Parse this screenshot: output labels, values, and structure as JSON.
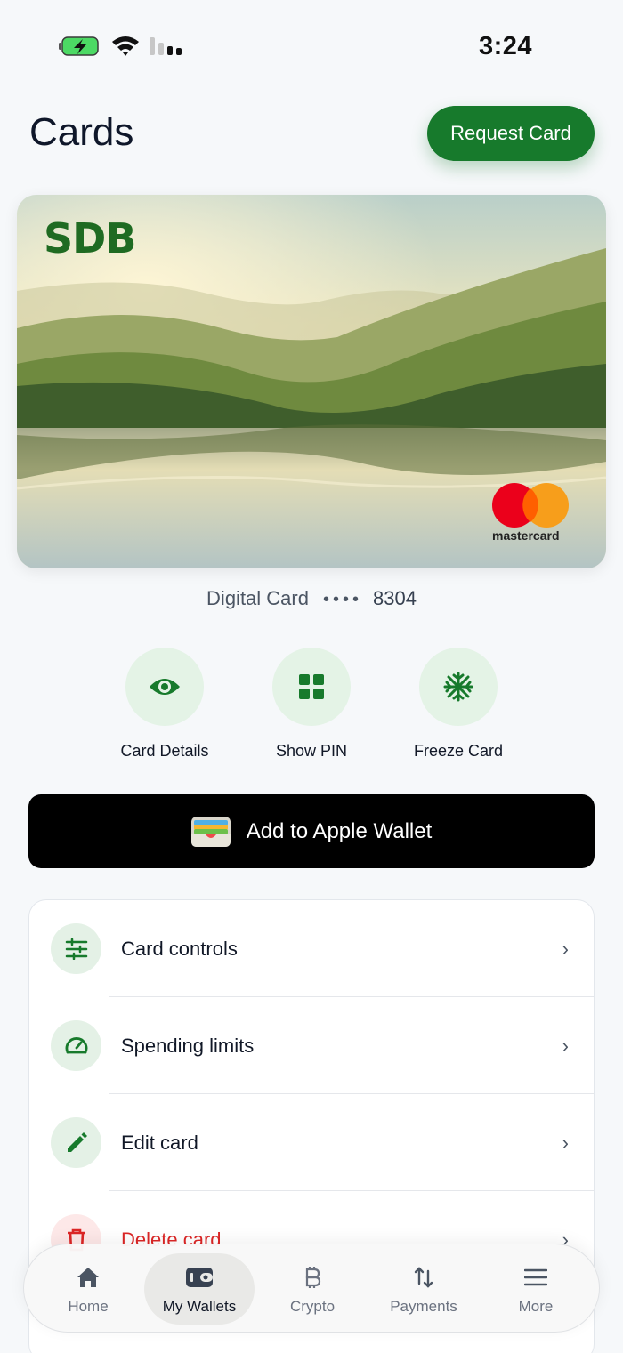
{
  "status_bar": {
    "time": "3:24"
  },
  "header": {
    "title": "Cards",
    "request_button": "Request Card"
  },
  "card": {
    "brand": "SDB",
    "network": "mastercard",
    "label": "Digital Card",
    "mask": "••••",
    "last4": "8304"
  },
  "actions": [
    {
      "label": "Card Details",
      "icon": "eye-icon"
    },
    {
      "label": "Show PIN",
      "icon": "grid-icon"
    },
    {
      "label": "Freeze Card",
      "icon": "snowflake-icon"
    }
  ],
  "wallet_button": "Add to Apple Wallet",
  "menu": [
    {
      "label": "Card controls",
      "icon": "sliders-icon"
    },
    {
      "label": "Spending limits",
      "icon": "gauge-icon"
    },
    {
      "label": "Edit card",
      "icon": "pencil-icon"
    },
    {
      "label": "Delete card",
      "icon": "trash-icon"
    }
  ],
  "tabs": [
    {
      "label": "Home",
      "icon": "home-icon"
    },
    {
      "label": "My Wallets",
      "icon": "wallet-icon",
      "active": true
    },
    {
      "label": "Crypto",
      "icon": "bitcoin-icon"
    },
    {
      "label": "Payments",
      "icon": "transfer-icon"
    },
    {
      "label": "More",
      "icon": "menu-icon"
    }
  ],
  "colors": {
    "accent": "#177a2c",
    "accent_soft": "#e4f3e6",
    "danger": "#dc2626"
  }
}
